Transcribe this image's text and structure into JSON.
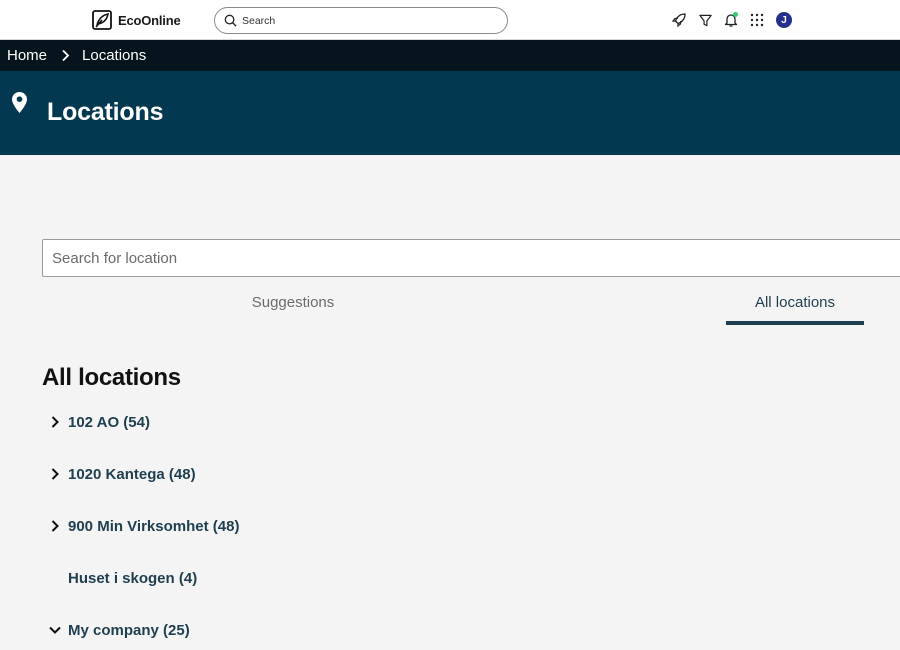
{
  "topbar": {
    "brand": "EcoOnline",
    "search_placeholder": "Search",
    "icons": [
      "rocket-icon",
      "filter-icon",
      "bell-icon",
      "apps-grid-icon"
    ],
    "avatar_initial": "J",
    "colors": {
      "avatar": "#24308c",
      "notification_dot": "#2ecc71"
    }
  },
  "breadcrumb": {
    "items": [
      "Home",
      "Locations"
    ]
  },
  "header": {
    "icon": "location-pin-icon",
    "title": "Locations",
    "color": "#023950"
  },
  "main": {
    "search_placeholder": "Search for location",
    "tabs": [
      {
        "label": "Suggestions",
        "active": false
      },
      {
        "label": "All locations",
        "active": true
      }
    ],
    "section_title": "All locations",
    "tree": [
      {
        "label": "102 AO (54)",
        "state": "collapsed"
      },
      {
        "label": "1020 Kantega (48)",
        "state": "collapsed"
      },
      {
        "label": "900 Min Virksomhet (48)",
        "state": "collapsed"
      },
      {
        "label": "Huset i skogen (4)",
        "state": "leaf"
      },
      {
        "label": "My company (25)",
        "state": "expanded"
      }
    ],
    "accent_color": "#1e3f4f"
  }
}
